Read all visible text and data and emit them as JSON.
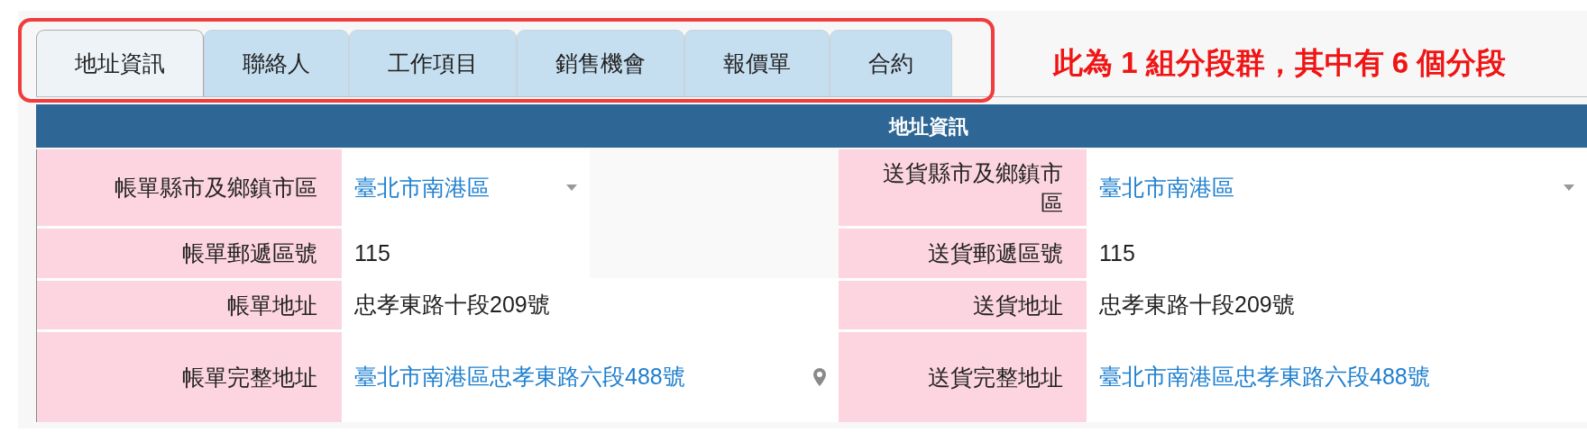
{
  "tabs": [
    {
      "label": "地址資訊",
      "selected": true
    },
    {
      "label": "聯絡人",
      "selected": false
    },
    {
      "label": "工作項目",
      "selected": false
    },
    {
      "label": "銷售機會",
      "selected": false
    },
    {
      "label": "報價單",
      "selected": false
    },
    {
      "label": "合約",
      "selected": false
    }
  ],
  "annotation": "此為 1 組分段群，其中有 6 個分段",
  "section": {
    "title": "地址資訊",
    "rows": [
      {
        "left": {
          "label": "帳單縣市及鄉鎮市區",
          "value": "臺北市南港區",
          "kind": "dropdown"
        },
        "right": {
          "label": "送貨縣市及鄉鎮市區",
          "value": "臺北市南港區",
          "kind": "dropdown"
        }
      },
      {
        "left": {
          "label": "帳單郵遞區號",
          "value": "115",
          "kind": "text"
        },
        "right": {
          "label": "送貨郵遞區號",
          "value": "115",
          "kind": "text"
        }
      },
      {
        "left": {
          "label": "帳單地址",
          "value": "忠孝東路十段209號",
          "kind": "text"
        },
        "right": {
          "label": "送貨地址",
          "value": "忠孝東路十段209號",
          "kind": "text"
        }
      },
      {
        "left": {
          "label": "帳單完整地址",
          "value": "臺北市南港區忠孝東路六段488號",
          "kind": "link",
          "map_icon": true
        },
        "right": {
          "label": "送貨完整地址",
          "value": "臺北市南港區忠孝東路六段488號",
          "kind": "link",
          "map_icon": false
        }
      }
    ]
  }
}
